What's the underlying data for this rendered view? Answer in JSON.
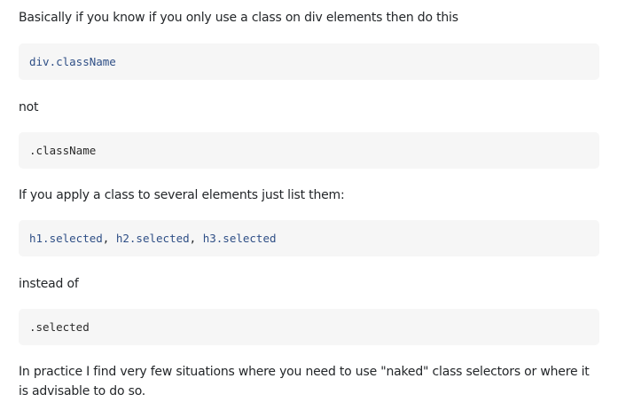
{
  "answer": {
    "para1": "Basically if you know if you only use a class on div elements then do this",
    "code1": {
      "a": "div",
      "b": ".className"
    },
    "para2": "not",
    "code2": ".className",
    "para3": "If you apply a class to several elements just list them:",
    "code3": {
      "s1": "h1.selected",
      "sep1": ", ",
      "s2": "h2.selected",
      "sep2": ", ",
      "s3": "h3.selected"
    },
    "para4": "instead of",
    "code4": ".selected",
    "para5": "In practice I find very few situations where you need to use \"naked\" class selectors or where it is advisable to do so."
  }
}
